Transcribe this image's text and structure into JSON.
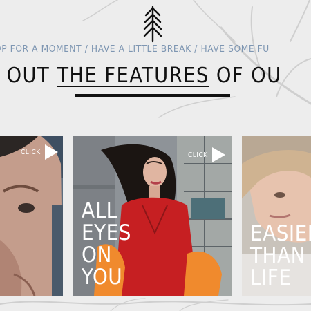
{
  "tagline": "OP FOR A MOMENT / HAVE A LITTLE BREAK / HAVE SOME FU",
  "heading": {
    "part1": "K OUT ",
    "part2": "THE FEATURES",
    "part3": " OF OU"
  },
  "cards": [
    {
      "click_label": "CLICK",
      "lines": []
    },
    {
      "click_label": "CLICK",
      "lines": [
        "ALL",
        "EYES",
        "ON",
        "YOU"
      ]
    },
    {
      "click_label": "",
      "lines": [
        "EASIER",
        "THAN",
        "LIFE"
      ]
    }
  ],
  "colors": {
    "tagline": "#7e96b2",
    "heading": "#111111",
    "background": "#eeeeee"
  }
}
